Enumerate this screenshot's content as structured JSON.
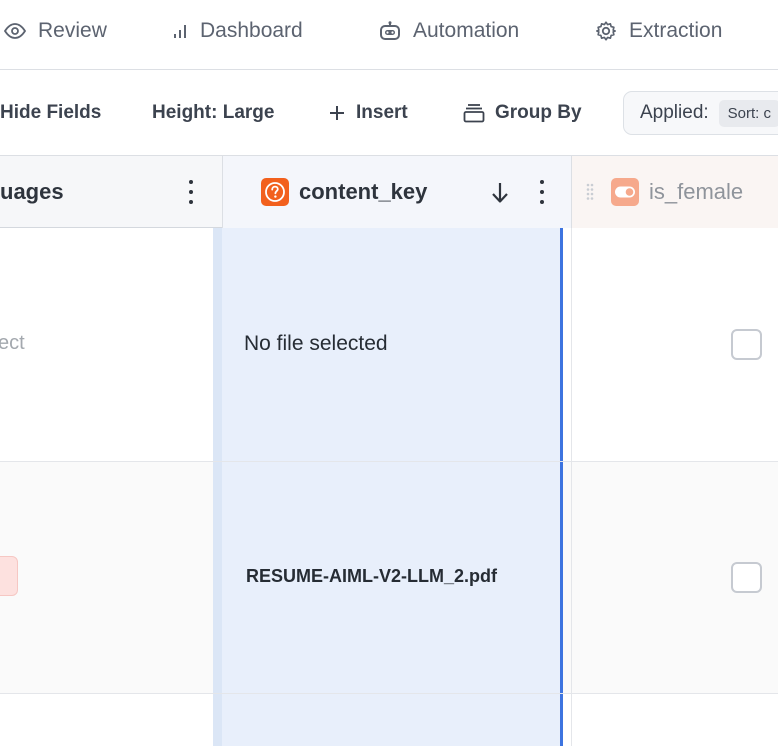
{
  "nav": {
    "tabs": [
      {
        "label": "Review",
        "icon": "eye-icon"
      },
      {
        "label": "Dashboard",
        "icon": "bar-chart-icon"
      },
      {
        "label": "Automation",
        "icon": "robot-icon"
      },
      {
        "label": "Extraction",
        "icon": "gear-icon"
      }
    ]
  },
  "toolbar": {
    "hide_fields": "Hide Fields",
    "height": "Height: Large",
    "insert": "Insert",
    "group_by": "Group By",
    "applied_label": "Applied:",
    "applied_chip": "Sort: c"
  },
  "columns": {
    "left_partial": "uages",
    "selected": "content_key",
    "right": "is_female"
  },
  "rows": [
    {
      "left_partial": "ect",
      "content_key": "No file selected",
      "is_female": false
    },
    {
      "left_partial": "",
      "content_key": "RESUME-AIML-V2-LLM_2.pdf",
      "is_female": false
    }
  ],
  "colors": {
    "accent": "#3d74e0",
    "selected_column": "#e8effb",
    "type_icon_orange": "#f2601d",
    "toggle_icon_orange": "#f6a98c"
  }
}
